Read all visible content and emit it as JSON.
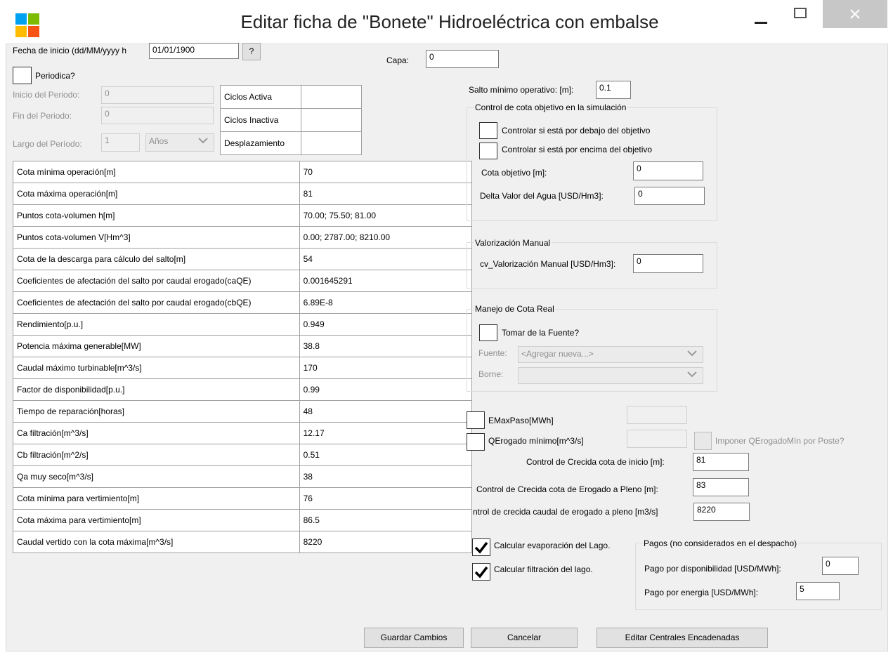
{
  "window": {
    "title": "Editar ficha de  \"Bonete\" Hidroeléctrica con embalse",
    "minimize_glyph": "—",
    "maximize_glyph": "☐",
    "close_glyph": "✕",
    "icon": "app-grid-icon"
  },
  "header": {
    "fecha_label": "Fecha de inicio (dd/MM/yyyy h",
    "fecha_value": "01/01/1900",
    "help_button": "?",
    "periodica_label": "Periodica?",
    "capa_label": "Capa:",
    "capa_value": "0",
    "inicio_label": "Inicio del Periodo:",
    "inicio_value": "0",
    "fin_label": "Fin del Periodo:",
    "fin_value": "0",
    "largo_label": "Largo del Período:",
    "largo_value": "1",
    "largo_unit": "Años"
  },
  "ciclos": [
    {
      "label": "Ciclos Activa",
      "value": ""
    },
    {
      "label": "Ciclos Inactiva",
      "value": ""
    },
    {
      "label": "Desplazamiento",
      "value": ""
    }
  ],
  "params": [
    {
      "name": "Cota mínima operación[m]",
      "value": "70"
    },
    {
      "name": "Cota máxima operación[m]",
      "value": "81"
    },
    {
      "name": "Puntos cota-volumen h[m]",
      "value": "70.00; 75.50; 81.00"
    },
    {
      "name": "Puntos cota-volumen V[Hm^3]",
      "value": "0.00; 2787.00; 8210.00"
    },
    {
      "name": "Cota de la descarga para cálculo del salto[m]",
      "value": "54"
    },
    {
      "name": "Coeficientes de afectación del salto por caudal erogado(caQE)",
      "value": "0.001645291"
    },
    {
      "name": "Coeficientes de afectación del salto por caudal erogado(cbQE)",
      "value": "6.89E-8"
    },
    {
      "name": "Rendimiento[p.u.]",
      "value": "0.949"
    },
    {
      "name": "Potencia máxima generable[MW]",
      "value": "38.8"
    },
    {
      "name": "Caudal máximo turbinable[m^3/s]",
      "value": "170"
    },
    {
      "name": "Factor de disponibilidad[p.u.]",
      "value": "0.99"
    },
    {
      "name": "Tiempo de reparación[horas]",
      "value": "48"
    },
    {
      "name": "Ca filtración[m^3/s]",
      "value": "12.17"
    },
    {
      "name": "Cb filtración[m^2/s]",
      "value": "0.51"
    },
    {
      "name": "Qa muy seco[m^3/s]",
      "value": "38"
    },
    {
      "name": "Cota mínima para vertimiento[m]",
      "value": "76"
    },
    {
      "name": "Cota máxima para vertimiento[m]",
      "value": "86.5"
    },
    {
      "name": "Caudal vertido con la cota máxima[m^3/s]",
      "value": "8220"
    }
  ],
  "right": {
    "salto_label": "Salto mínimo operativo: [m]:",
    "salto_value": "0.1",
    "control_group_title": "Control de cota objetivo en la simulación",
    "debajo_label": "Controlar si está por debajo del objetivo",
    "encima_label": "Controlar si está por encima del objetivo",
    "cota_obj_label": "Cota objetivo  [m]:",
    "cota_obj_value": "0",
    "delta_label": "Delta Valor del Agua [USD/Hm3]:",
    "delta_value": "0",
    "valorizacion_title": "Valorización Manual",
    "cv_label": "cv_Valorización Manual [USD/Hm3]:",
    "cv_value": "0",
    "manejo_title": "Manejo de Cota Real",
    "tomar_label": "Tomar de la Fuente?",
    "fuente_label": "Fuente:",
    "fuente_value": "<Agregar nueva...>",
    "borne_label": "Borne:",
    "borne_value": "",
    "emax_label": "EMaxPaso[MWh]",
    "qerog_label": "QErogado mínimo[m^3/s]",
    "imponer_label": "Imponer QErogadoMín por Poste?",
    "crecida_inicio_label": "Control de Crecida cota de inicio [m]:",
    "crecida_inicio_value": "81",
    "crecida_pleno_label": "Control de Crecida cota de Erogado a Pleno [m]:",
    "crecida_pleno_value": "83",
    "crecida_caudal_label": "ntrol de crecida caudal de erogado a pleno [m3/s]",
    "crecida_caudal_value": "8220",
    "evap_label": "Calcular evaporación del Lago.",
    "filt_label": "Calcular filtración del lago.",
    "pagos_title": "Pagos (no considerados en el despacho)",
    "pago_disp_label": "Pago por disponibilidad [USD/MWh]:",
    "pago_disp_value": "0",
    "pago_energia_label": "Pago por energia  [USD/MWh]:",
    "pago_energia_value": "5"
  },
  "buttons": {
    "guardar": "Guardar Cambios",
    "cancelar": "Cancelar",
    "editar": "Editar Centrales Encadenadas"
  },
  "colors": {
    "icon_green": "#7cbb00",
    "icon_blue": "#00a1f1",
    "icon_yellow": "#ffbb00",
    "icon_red": "#f65314",
    "close_hover": "#e81123"
  }
}
